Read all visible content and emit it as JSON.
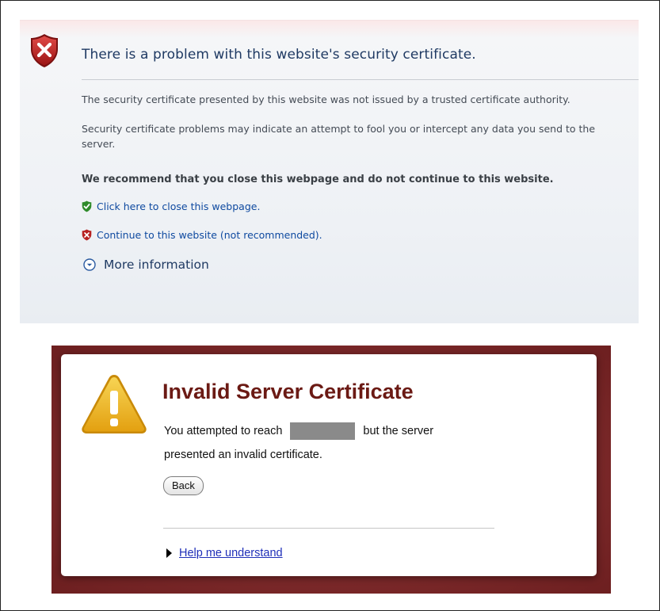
{
  "ie_page": {
    "title": "There is a problem with this website's security certificate.",
    "paragraph1": "The security certificate presented by this website was not issued by a trusted certificate authority.",
    "paragraph2": "Security certificate problems may indicate an attempt to fool you or intercept any data you send to the server.",
    "recommendation": "We recommend that you close this webpage and do not continue to this website.",
    "close_link": "Click here to close this webpage.",
    "continue_link": "Continue to this website (not recommended).",
    "more_info": "More information",
    "icons": {
      "main": "red-shield-x-icon",
      "close": "green-shield-check-icon",
      "continue": "red-shield-x-icon",
      "more": "chevron-down-circle-icon"
    }
  },
  "chrome_page": {
    "title": "Invalid Server Certificate",
    "message_part1": "You attempted to reach",
    "message_part2": "but the server",
    "message_line2": "presented an invalid certificate.",
    "back_button": "Back",
    "help_link": "Help me understand",
    "icons": {
      "warning": "warning-triangle-icon",
      "expand": "triangle-right-icon"
    }
  },
  "colors": {
    "ie_title": "#1f3a63",
    "ie_link": "#0f4aa0",
    "chrome_background": "#7a2425",
    "chrome_title": "#6b1a14",
    "warning_yellow": "#f0b81f"
  }
}
